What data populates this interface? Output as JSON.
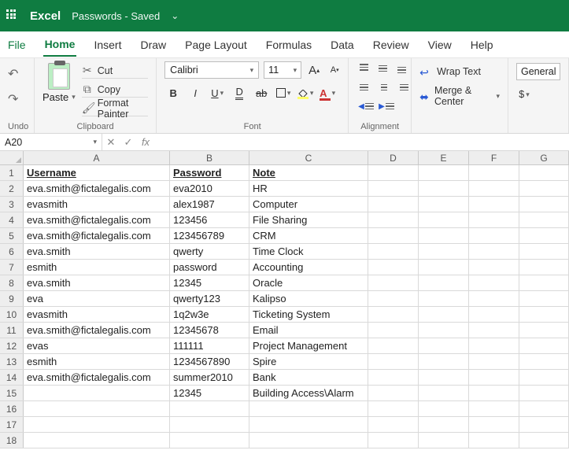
{
  "app": {
    "name": "Excel",
    "document": "Passwords - Saved"
  },
  "tabs": {
    "file": "File",
    "home": "Home",
    "insert": "Insert",
    "draw": "Draw",
    "pageLayout": "Page Layout",
    "formulas": "Formulas",
    "data": "Data",
    "review": "Review",
    "view": "View",
    "help": "Help"
  },
  "ribbon": {
    "undoLabel": "Undo",
    "clipboard": {
      "paste": "Paste",
      "cut": "Cut",
      "copy": "Copy",
      "formatPainter": "Format Painter",
      "label": "Clipboard"
    },
    "font": {
      "name": "Calibri",
      "size": "11",
      "label": "Font"
    },
    "alignment": {
      "label": "Alignment",
      "wrap": "Wrap Text",
      "merge": "Merge & Center"
    },
    "number": {
      "format": "General",
      "currency": "$"
    }
  },
  "namebox": "A20",
  "columns": [
    "A",
    "B",
    "C",
    "D",
    "E",
    "F",
    "G"
  ],
  "headers": {
    "A": "Username",
    "B": "Password",
    "C": "Note"
  },
  "rows": [
    {
      "n": 2,
      "A": "eva.smith@fictalegalis.com",
      "B": "eva2010",
      "C": "HR"
    },
    {
      "n": 3,
      "A": "evasmith",
      "B": "alex1987",
      "C": "Computer"
    },
    {
      "n": 4,
      "A": "eva.smith@fictalegalis.com",
      "B": "123456",
      "C": "File Sharing"
    },
    {
      "n": 5,
      "A": "eva.smith@fictalegalis.com",
      "B": "123456789",
      "C": "CRM"
    },
    {
      "n": 6,
      "A": "eva.smith",
      "B": "qwerty",
      "C": "Time Clock"
    },
    {
      "n": 7,
      "A": "esmith",
      "B": "password",
      "C": "Accounting"
    },
    {
      "n": 8,
      "A": "eva.smith",
      "B": "12345",
      "C": "Oracle"
    },
    {
      "n": 9,
      "A": "eva",
      "B": "qwerty123",
      "C": "Kalipso"
    },
    {
      "n": 10,
      "A": "evasmith",
      "B": "1q2w3e",
      "C": "Ticketing System"
    },
    {
      "n": 11,
      "A": "eva.smith@fictalegalis.com",
      "B": "12345678",
      "C": "Email"
    },
    {
      "n": 12,
      "A": "evas",
      "B": "111111",
      "C": "Project Management"
    },
    {
      "n": 13,
      "A": "esmith",
      "B": "1234567890",
      "C": "Spire"
    },
    {
      "n": 14,
      "A": "eva.smith@fictalegalis.com",
      "B": "summer2010",
      "C": "Bank"
    },
    {
      "n": 15,
      "A": "",
      "B": "12345",
      "C": "Building Access\\Alarm"
    },
    {
      "n": 16,
      "A": "",
      "B": "",
      "C": ""
    },
    {
      "n": 17,
      "A": "",
      "B": "",
      "C": ""
    },
    {
      "n": 18,
      "A": "",
      "B": "",
      "C": ""
    }
  ]
}
